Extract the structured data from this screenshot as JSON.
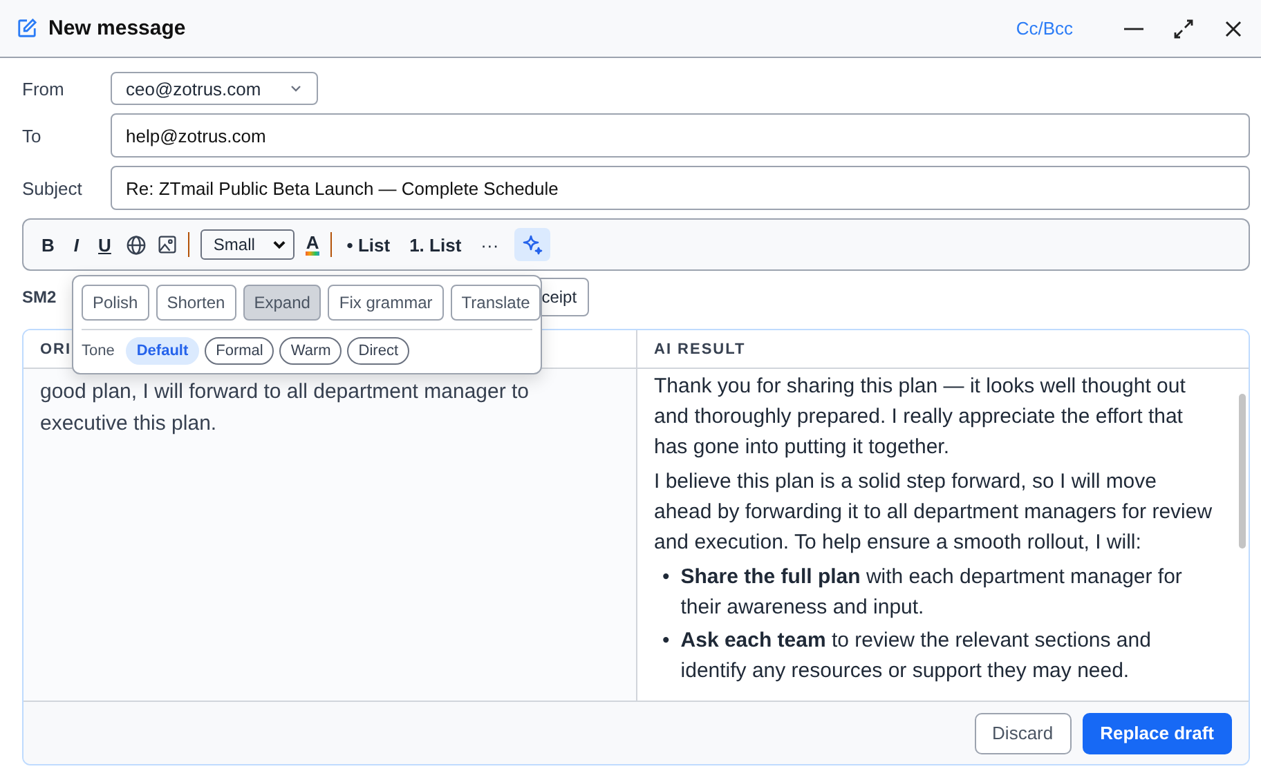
{
  "window": {
    "title": "New message",
    "cc_bcc": "Cc/Bcc"
  },
  "fields": [
    {
      "kind": "select",
      "label": "From",
      "value": "ceo@zotrus.com"
    },
    {
      "kind": "text",
      "label": "To",
      "value": "help@zotrus.com"
    },
    {
      "kind": "text",
      "label": "Subject",
      "value": "Re: ZTmail Public Beta Launch — Complete Schedule"
    }
  ],
  "toolbar": [
    {
      "kind": "bold",
      "label": "B"
    },
    {
      "kind": "italic",
      "label": "I"
    },
    {
      "kind": "underline",
      "label": "U"
    },
    {
      "kind": "link"
    },
    {
      "kind": "image"
    },
    {
      "kind": "separator"
    },
    {
      "kind": "select",
      "label": "Small"
    },
    {
      "kind": "color",
      "label": "A"
    },
    {
      "kind": "separator"
    },
    {
      "kind": "list",
      "label": "• List"
    },
    {
      "kind": "list",
      "label": "1. List"
    },
    {
      "kind": "more",
      "label": "···"
    },
    {
      "kind": "ai",
      "selected": true
    }
  ],
  "below_toolbar": {
    "label": "SM2",
    "button": "ceipt"
  },
  "ai_menu": {
    "actions": [
      {
        "label": "Polish",
        "selected": false
      },
      {
        "label": "Shorten",
        "selected": false
      },
      {
        "label": "Expand",
        "selected": true
      },
      {
        "label": "Fix grammar",
        "selected": false
      },
      {
        "label": "Translate",
        "selected": false
      }
    ],
    "tone_label": "Tone",
    "tones": [
      {
        "label": "Default",
        "selected": true
      },
      {
        "label": "Formal",
        "selected": false
      },
      {
        "label": "Warm",
        "selected": false
      },
      {
        "label": "Direct",
        "selected": false
      }
    ]
  },
  "compare": {
    "original_heading": "ORI",
    "result_heading": "AI RESULT",
    "original_text": "good plan, I will forward to all department manager to executive this plan.",
    "result": [
      {
        "kind": "paragraph",
        "text": "Thank you for sharing this plan — it looks well thought out and thoroughly prepared. I really appreciate the effort that has gone into putting it together."
      },
      {
        "kind": "paragraph",
        "text": "I believe this plan is a solid step forward, so I will move ahead by forwarding it to all department managers for review and execution. To help ensure a smooth rollout, I will:"
      },
      {
        "kind": "bullet",
        "marker": "•",
        "text": "**Share the full plan** with each department manager for their awareness and input."
      },
      {
        "kind": "bullet",
        "marker": "•",
        "text": "**Ask each team** to review the relevant sections and identify any resources or support they may need."
      }
    ],
    "buttons": [
      {
        "kind": "secondary",
        "label": "Discard"
      },
      {
        "kind": "primary",
        "label": "Replace draft"
      }
    ]
  }
}
